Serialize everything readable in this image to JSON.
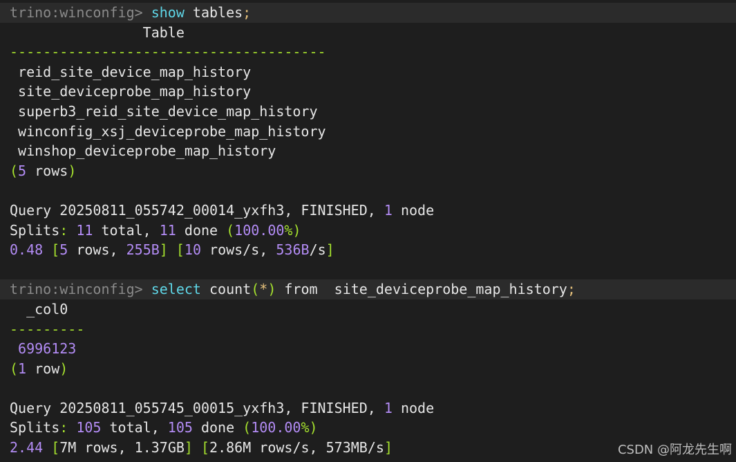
{
  "query1": {
    "prompt": "trino:winconfig>",
    "keyword": "show",
    "rest": "tables",
    "semicolon": ";"
  },
  "result1": {
    "header": "                Table",
    "separator": "--------------------------------------",
    "rows": [
      " reid_site_device_map_history",
      " site_deviceprobe_map_history",
      " superb3_reid_site_device_map_history",
      " winconfig_xsj_deviceprobe_map_history",
      " winshop_deviceprobe_map_history"
    ],
    "row_count": "5",
    "row_word": " rows"
  },
  "stats1": {
    "query_label": "Query 20250811_055742_00014_yxfh3, FINISHED, ",
    "nodes": "1",
    "node_word": " node",
    "splits_label": "Splits",
    "splits_total": "11",
    "splits_done": "11",
    "splits_pct": "100.00",
    "time": "0.48",
    "rows": "5",
    "bytes": "255",
    "rows_rate": "10",
    "bytes_rate": "536"
  },
  "query2": {
    "prompt": "trino:winconfig>",
    "keyword": "select",
    "func": "count",
    "star": "*",
    "from": "from",
    "table": "site_deviceprobe_map_history",
    "semicolon": ";"
  },
  "result2": {
    "header": "  _col0",
    "separator": "---------",
    "value": "6996123",
    "row_count": "1",
    "row_word": " row"
  },
  "stats2": {
    "query_label": "Query 20250811_055745_00015_yxfh3, FINISHED, ",
    "nodes": "1",
    "node_word": " node",
    "splits_label": "Splits",
    "splits_total": "105",
    "splits_done": "105",
    "splits_pct": "100.00",
    "time": "2.44",
    "rows": "7M",
    "bytes": "1.37GB",
    "rows_rate": "2.86M",
    "bytes_rate": "573MB"
  },
  "watermark": "CSDN @阿龙先生啊",
  "colors": {
    "background": "#1e1e1e",
    "prompt": "#8a8a8a",
    "keyword": "#5fd7e8",
    "number": "#b38cf5",
    "punctuation": "#a6e22e",
    "semicolon": "#e5c07b",
    "text": "#e6e6e6"
  }
}
